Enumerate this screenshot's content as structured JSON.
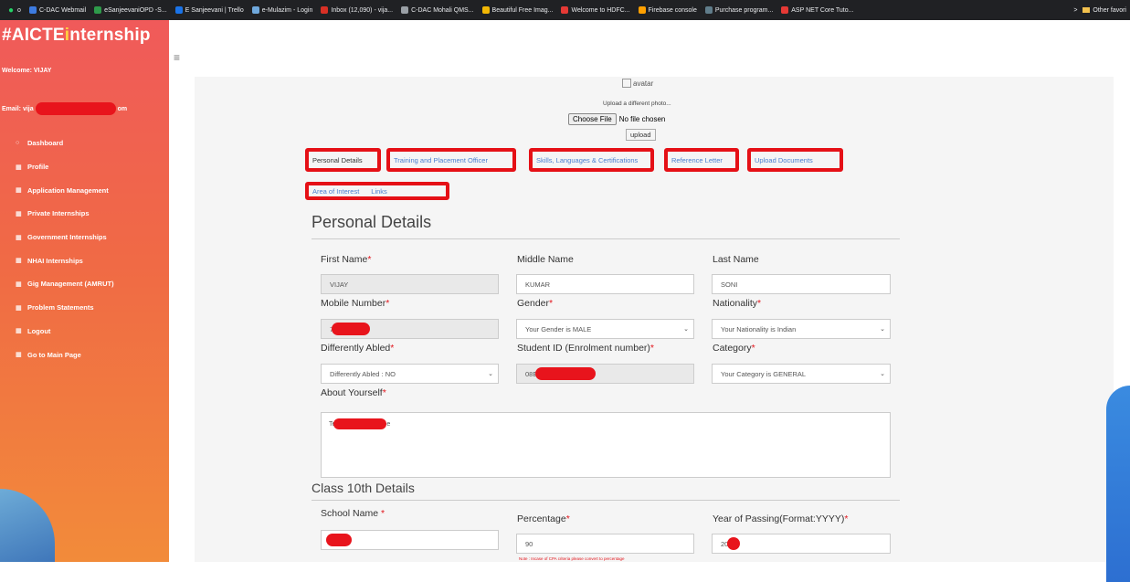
{
  "browser": {
    "bookmarks": [
      {
        "label": "C-DAC Webmail",
        "color": "#3d7be0"
      },
      {
        "label": "eSanjeevaniOPD -S...",
        "color": "#2e9a4a"
      },
      {
        "label": "E Sanjeevani | Trello",
        "color": "#1a73e8"
      },
      {
        "label": "e-Mulazim - Login",
        "color": "#6fa8dc"
      },
      {
        "label": "Inbox (12,090) - vija...",
        "color": "#d93025"
      },
      {
        "label": "C-DAC Mohali QMS...",
        "color": "#9aa0a6"
      },
      {
        "label": "Beautiful Free Imag...",
        "color": "#f2b705"
      },
      {
        "label": "Welcome to HDFC...",
        "color": "#e53935"
      },
      {
        "label": "Firebase console",
        "color": "#ffa000"
      },
      {
        "label": "Purchase program...",
        "color": "#607d8b"
      },
      {
        "label": "ASP NET Core Tuto...",
        "color": "#e53935"
      }
    ],
    "more": ">",
    "other_favorites": "Other favori"
  },
  "sidebar": {
    "brand_prefix": "#AICTE",
    "brand_i": "i",
    "brand_suffix": "nternship",
    "welcome": "Welcome: VIJAY",
    "email_prefix": "Email: vija",
    "email_suffix": "om",
    "items": [
      {
        "label": "Dashboard",
        "icon": "○"
      },
      {
        "label": "Profile",
        "icon": "▦"
      },
      {
        "label": "Application Management",
        "icon": "▦"
      },
      {
        "label": "Private Internships",
        "icon": "▦"
      },
      {
        "label": "Government Internships",
        "icon": "▦"
      },
      {
        "label": "NHAI Internships",
        "icon": "▦"
      },
      {
        "label": "Gig Management (AMRUT)",
        "icon": "▦"
      },
      {
        "label": "Problem Statements",
        "icon": "▦"
      },
      {
        "label": "Logout",
        "icon": "▦"
      },
      {
        "label": "Go to Main Page",
        "icon": "▦"
      }
    ]
  },
  "header": {
    "menu_icon": "≡"
  },
  "photo": {
    "avatar_alt": "avatar",
    "upload_text": "Upload a different photo...",
    "choose_label": "Choose File",
    "no_file": "No file chosen",
    "upload_button": "upload"
  },
  "tabs": [
    "Personal Details",
    "Training and Placement Officer",
    "Skills, Languages & Certifications",
    "Reference Letter",
    "Upload Documents",
    "Area of Interest",
    "Links"
  ],
  "personal": {
    "title": "Personal Details",
    "first_name_label": "First Name",
    "middle_name_label": "Middle Name",
    "last_name_label": "Last Name",
    "first_name": "VIJAY",
    "middle_name": "KUMAR",
    "last_name": "SONI",
    "mobile_label": "Mobile Number",
    "mobile_prefix": "7",
    "gender_label": "Gender",
    "gender_value": "Your Gender is MALE",
    "nationality_label": "Nationality",
    "nationality_value": "Your Nationality is Indian",
    "disabled_label": "Differently Abled",
    "disabled_value": "Differently Abled : NO",
    "student_id_label": "Student ID (Enrolment number)",
    "student_id_prefix": "08E",
    "category_label": "Category",
    "category_value": "Your Category is GENERAL",
    "about_label": "About Yourself",
    "about_prefix": "Te",
    "about_suffix": "e",
    "required_mark": "*"
  },
  "class10": {
    "title": "Class 10th Details",
    "school_label": "School Name ",
    "percentage_label": "Percentage",
    "percentage": "90",
    "year_label": "Year of Passing(Format:YYYY)",
    "year_prefix": "20",
    "note": "Note : Incase of CPA criteria please convert to percentage"
  }
}
